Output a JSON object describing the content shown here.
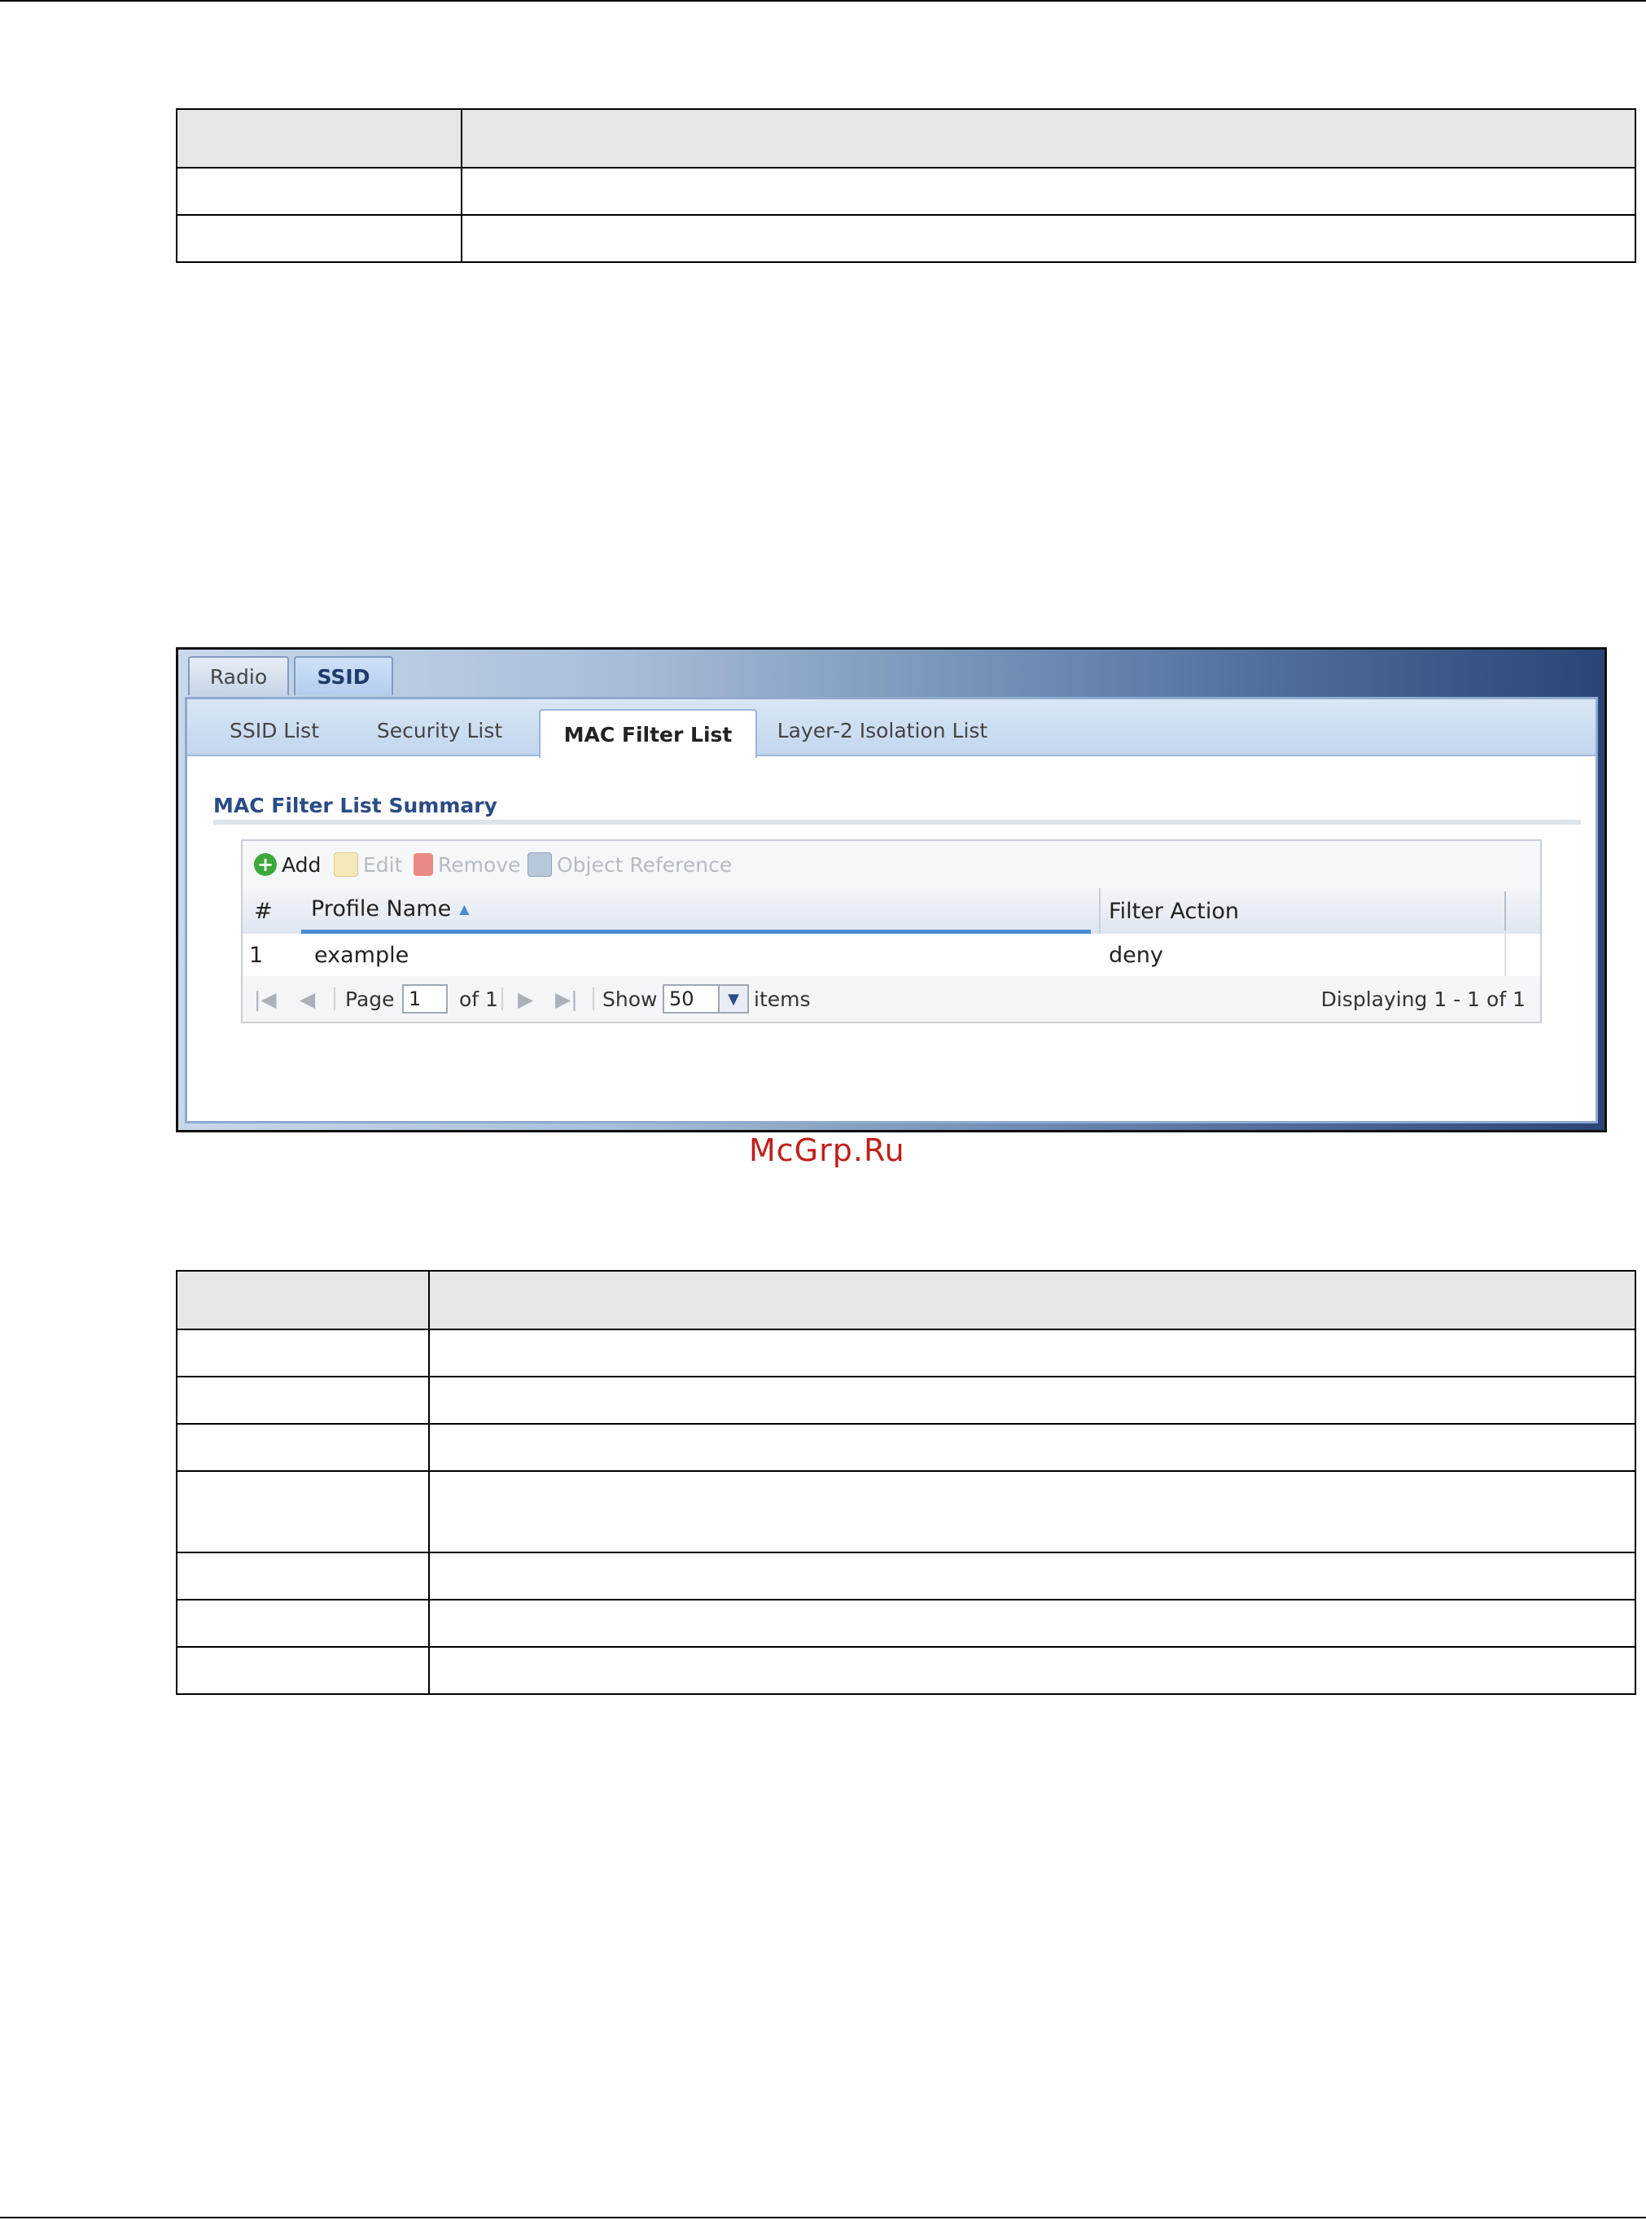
{
  "tabs": {
    "radio": "Radio",
    "ssid": "SSID"
  },
  "subtabs": [
    "SSID List",
    "Security List",
    "MAC Filter List",
    "Layer-2 Isolation List"
  ],
  "section_title": "MAC Filter List Summary",
  "toolbar": {
    "add": "Add",
    "edit": "Edit",
    "remove": "Remove",
    "object_reference": "Object Reference"
  },
  "columns": {
    "num": "#",
    "profile_name": "Profile Name",
    "filter_action": "Filter Action"
  },
  "rows": [
    {
      "num": "1",
      "profile_name": "example",
      "filter_action": "deny"
    }
  ],
  "pager": {
    "page_label": "Page",
    "page_value": "1",
    "of_label": "of 1",
    "show_label": "Show",
    "show_value": "50",
    "items_label": "items",
    "displaying": "Displaying 1 - 1 of 1"
  },
  "watermark": "McGrp.Ru",
  "colors": {
    "accent": "#2a4c86",
    "banner_dark": "#2a4476",
    "add_green": "#3aa83a",
    "remove_red": "#d9534f"
  }
}
